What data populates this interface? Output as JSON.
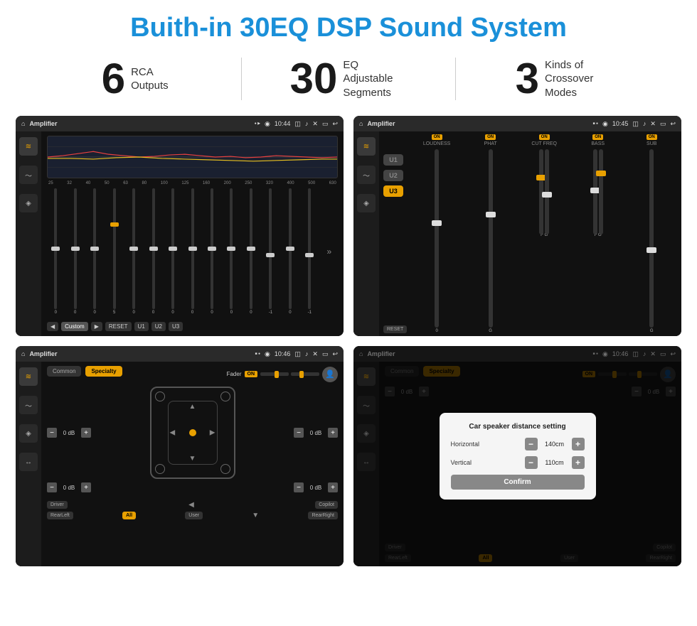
{
  "page": {
    "title": "Buith-in 30EQ DSP Sound System",
    "stats": [
      {
        "number": "6",
        "label": "RCA\nOutputs"
      },
      {
        "number": "30",
        "label": "EQ Adjustable\nSegments"
      },
      {
        "number": "3",
        "label": "Kinds of\nCrossover Modes"
      }
    ]
  },
  "screens": {
    "eq": {
      "title": "Amplifier",
      "time": "10:44",
      "freqs": [
        "25",
        "32",
        "40",
        "50",
        "63",
        "80",
        "100",
        "125",
        "160",
        "200",
        "250",
        "320",
        "400",
        "500",
        "630"
      ],
      "values": [
        "0",
        "0",
        "0",
        "5",
        "0",
        "0",
        "0",
        "0",
        "0",
        "0",
        "0",
        "-1",
        "0",
        "-1"
      ],
      "presets": [
        "Custom",
        "RESET",
        "U1",
        "U2",
        "U3"
      ]
    },
    "crossover": {
      "title": "Amplifier",
      "time": "10:45",
      "channels": [
        "LOUDNESS",
        "PHAT",
        "CUT FREQ",
        "BASS",
        "SUB"
      ],
      "u_buttons": [
        "U1",
        "U2",
        "U3"
      ],
      "reset_label": "RESET"
    },
    "fader": {
      "title": "Amplifier",
      "time": "10:46",
      "tabs": [
        "Common",
        "Specialty"
      ],
      "fader_label": "Fader",
      "on_label": "ON",
      "db_values": [
        "0 dB",
        "0 dB",
        "0 dB",
        "0 dB"
      ],
      "buttons": [
        "Driver",
        "Copilot",
        "RearLeft",
        "All",
        "User",
        "RearRight"
      ]
    },
    "dialog": {
      "title": "Amplifier",
      "time": "10:46",
      "tabs": [
        "Common",
        "Specialty"
      ],
      "dialog_title": "Car speaker distance setting",
      "horizontal_label": "Horizontal",
      "horizontal_value": "140cm",
      "vertical_label": "Vertical",
      "vertical_value": "110cm",
      "confirm_label": "Confirm",
      "db_values": [
        "0 dB",
        "0 dB"
      ],
      "buttons": [
        "Driver",
        "Copilot",
        "RearLeft",
        "All",
        "User",
        "RearRight"
      ]
    }
  },
  "icons": {
    "home": "⌂",
    "location": "◉",
    "camera": "◫",
    "volume": "♪",
    "close": "✕",
    "back": "↩",
    "eq_icon": "≋",
    "wave_icon": "〜",
    "speaker_icon": "◈",
    "settings_icon": "⚙",
    "expand": "»",
    "play": "▶",
    "prev": "◀",
    "plus": "+",
    "minus": "−"
  }
}
